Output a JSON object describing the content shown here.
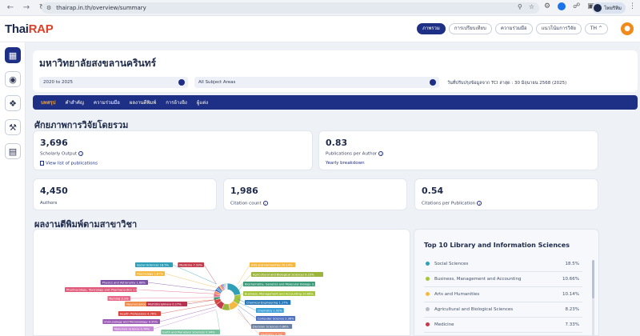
{
  "browser": {
    "url": "thairap.in.th/overview/summary",
    "profile_name": "ไทยริทิม"
  },
  "header": {
    "logo_main": "Thai",
    "logo_accent": "RAP",
    "nav": [
      {
        "label": "ภาพรวม",
        "active": true
      },
      {
        "label": "การเปรียบเทียบ",
        "active": false
      },
      {
        "label": "ความร่วมมือ",
        "active": false
      },
      {
        "label": "แนวโน้มการวิจัย",
        "active": false
      },
      {
        "label": "TH ^",
        "active": false
      }
    ]
  },
  "left_rail": [
    "overview-icon",
    "globe-icon",
    "network-icon",
    "tools-icon",
    "report-icon"
  ],
  "university": {
    "name": "มหาวิทยาลัยสงขลานครินทร์",
    "year_range": "2020 to 2025",
    "subject_filter": "All Subject Areas",
    "update_note": "วันที่ปรับปรุงข้อมูลจาก TCI ล่าสุด : 30 มิถุนายน 2568 (2025)"
  },
  "tabs": [
    {
      "label": "บทสรุป",
      "active": true
    },
    {
      "label": "คำสำคัญ",
      "active": false
    },
    {
      "label": "ความร่วมมือ",
      "active": false
    },
    {
      "label": "ผลงานตีพิมพ์",
      "active": false
    },
    {
      "label": "การอ้างอิง",
      "active": false
    },
    {
      "label": "ผู้แต่ง",
      "active": false
    }
  ],
  "overview": {
    "title": "ศักยภาพการวิจัยโดยรวม",
    "scholarly_output": {
      "value": "3,696",
      "label": "Scholarly Output",
      "link": "View list of publications"
    },
    "pubs_per_author": {
      "value": "0.83",
      "label": "Publications per Author",
      "link": "Yearly breakdown"
    },
    "authors": {
      "value": "4,450",
      "label": "Authors"
    },
    "citation_count": {
      "value": "1,986",
      "label": "Citation count"
    },
    "citations_per_pub": {
      "value": "0.54",
      "label": "Citations per Publication"
    }
  },
  "publications_section": {
    "title": "ผลงานตีพิมพ์ตามสาขาวิชา"
  },
  "chart_data": {
    "type": "pie",
    "labels": [
      {
        "text": "Social Sciences 18.5%",
        "color": "#2f9fb8"
      },
      {
        "text": "Psychology 1.67%",
        "color": "#f5b942"
      },
      {
        "text": "Physics and Astronomy 1.68%",
        "color": "#7b4fa3"
      },
      {
        "text": "Pharmacology, Toxicology and Pharmaceutics 1.66%",
        "color": "#e05a7a"
      },
      {
        "text": "Nursing 3.1%",
        "color": "#e86a8a"
      },
      {
        "text": "Neuroscience 0.68%",
        "color": "#f08a48"
      },
      {
        "text": "Multidisciplinary 0.17%",
        "color": "#b83252"
      },
      {
        "text": "Medicine 7.33%",
        "color": "#c43a4a"
      },
      {
        "text": "Health Professions 4.76%",
        "color": "#d9463e"
      },
      {
        "text": "Immunology and Microbiology 0.95%",
        "color": "#9b59b6"
      },
      {
        "text": "Materials Science 0.74%",
        "color": "#c98ad8"
      },
      {
        "text": "Arts and Humanities 10.14%",
        "color": "#f5b942"
      },
      {
        "text": "Agricultural and Biological Sciences 8.23%",
        "color": "#9cb53c"
      },
      {
        "text": "Biochemistry, Genetics and Molecular Biology 3.35%",
        "color": "#3b9a7a"
      },
      {
        "text": "Business, Management and Accounting 10.66%",
        "color": "#a5c43a"
      },
      {
        "text": "Chemical Engineering 1.17%",
        "color": "#2878b8"
      },
      {
        "text": "Chemistry 1.92%",
        "color": "#3aa0d8"
      },
      {
        "text": "Computer Science 2.36%",
        "color": "#4c6fbf"
      },
      {
        "text": "Decision Sciences 0.86%",
        "color": "#6b7fa0"
      },
      {
        "text": "Dentistry 3.1%",
        "color": "#f58f6a"
      },
      {
        "text": "Earth and Planetary Sciences 0.94%",
        "color": "#78c2a0"
      }
    ],
    "slices": [
      {
        "name": "Social Sciences",
        "value": 18.5,
        "color": "#2f9fb8"
      },
      {
        "name": "Business, Management and Accounting",
        "value": 10.66,
        "color": "#a5c43a"
      },
      {
        "name": "Arts and Humanities",
        "value": 10.14,
        "color": "#f5b942"
      },
      {
        "name": "Agricultural and Biological Sciences",
        "value": 8.23,
        "color": "#9cb53c"
      },
      {
        "name": "Medicine",
        "value": 7.33,
        "color": "#c43a4a"
      },
      {
        "name": "Health Professions",
        "value": 4.76,
        "color": "#d9463e"
      },
      {
        "name": "Biochemistry, Genetics and Molecular Biology",
        "value": 3.35,
        "color": "#3b9a7a"
      },
      {
        "name": "Nursing",
        "value": 3.1,
        "color": "#e86a8a"
      },
      {
        "name": "Dentistry",
        "value": 3.1,
        "color": "#f58f6a"
      },
      {
        "name": "Computer Science",
        "value": 2.36,
        "color": "#4c6fbf"
      },
      {
        "name": "Chemistry",
        "value": 1.92,
        "color": "#3aa0d8"
      },
      {
        "name": "Physics and Astronomy",
        "value": 1.68,
        "color": "#7b4fa3"
      },
      {
        "name": "Psychology",
        "value": 1.67,
        "color": "#f5b942"
      },
      {
        "name": "Pharmacology, Toxicology and Pharmaceutics",
        "value": 1.66,
        "color": "#e05a7a"
      },
      {
        "name": "Chemical Engineering",
        "value": 1.17,
        "color": "#2878b8"
      },
      {
        "name": "Immunology and Microbiology",
        "value": 0.95,
        "color": "#9b59b6"
      },
      {
        "name": "Earth and Planetary Sciences",
        "value": 0.94,
        "color": "#78c2a0"
      },
      {
        "name": "Decision Sciences",
        "value": 0.86,
        "color": "#6b7fa0"
      },
      {
        "name": "Materials Science",
        "value": 0.74,
        "color": "#c98ad8"
      },
      {
        "name": "Neuroscience",
        "value": 0.68,
        "color": "#f08a48"
      },
      {
        "name": "Multidisciplinary",
        "value": 0.17,
        "color": "#b83252"
      }
    ]
  },
  "top10": {
    "title": "Top 10 Library and Information Sciences",
    "rows": [
      {
        "name": "Social Sciences",
        "pct": "18.5%",
        "color": "#2f9fb8"
      },
      {
        "name": "Business, Management and Accounting",
        "pct": "10.66%",
        "color": "#a5c43a"
      },
      {
        "name": "Arts and Humanities",
        "pct": "10.14%",
        "color": "#f5b942"
      },
      {
        "name": "Agricultural and Biological Sciences",
        "pct": "8.23%",
        "color": "#b8bcc6"
      },
      {
        "name": "Medicine",
        "pct": "7.33%",
        "color": "#c43a4a"
      }
    ]
  }
}
